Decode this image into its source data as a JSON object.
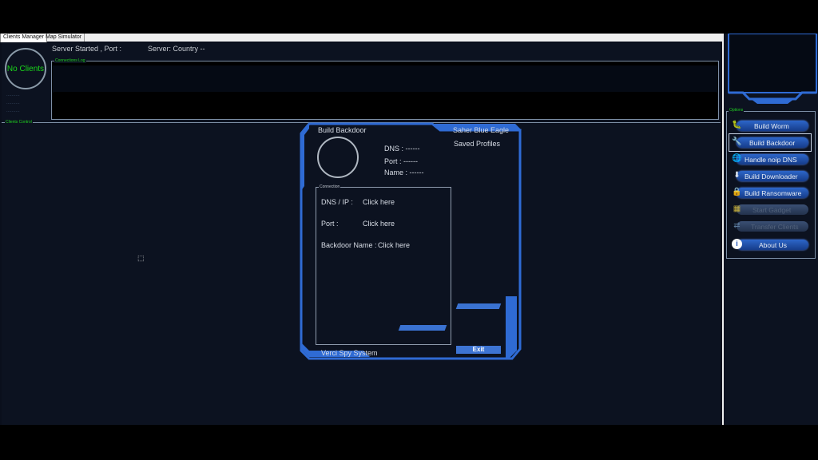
{
  "tabs": [
    {
      "label": "Clients Manager"
    },
    {
      "label": "Map Simulator"
    }
  ],
  "status": {
    "no_clients": "No Clients",
    "server_started": "Server Started , Port :",
    "server_country": "Server: Country --",
    "dashes": "..........",
    "connections_log": "Connections Log",
    "clients_control": "Clients Control"
  },
  "dialog": {
    "title": "Build Backdoor",
    "tab_name": "Saher Blue Eagle",
    "saved_profiles": "Saved Profiles",
    "dns_label": "DNS : ------",
    "port_label": "Port : ------",
    "name_label": "Name : ------",
    "connection_legend": "Connection",
    "dns_ip": "DNS / IP :",
    "dns_value": "Click here",
    "port": "Port :",
    "port_value": "Click here",
    "backdoor_name": "Backdoor Name :",
    "backdoor_value": "Click here",
    "footer": "Verci Spy System",
    "exit": "Exit"
  },
  "sidebar": {
    "options_legend": "Options",
    "items": [
      {
        "label": "Build Worm",
        "icon": "worm-icon"
      },
      {
        "label": "Build Backdoor",
        "icon": "backdoor-icon"
      },
      {
        "label": "Handle noip DNS",
        "icon": "dns-icon"
      },
      {
        "label": "Build Downloader",
        "icon": "download-icon"
      },
      {
        "label": "Build Ransomware",
        "icon": "lock-icon"
      },
      {
        "label": "Start Gadget",
        "icon": "gadget-icon"
      },
      {
        "label": "Transfer Clients",
        "icon": "transfer-icon"
      },
      {
        "label": "About Us",
        "icon": "info-icon"
      }
    ]
  },
  "colors": {
    "accent_blue": "#2f6bd4",
    "client_green": "#1bd81b",
    "background": "#0a0f1c"
  }
}
